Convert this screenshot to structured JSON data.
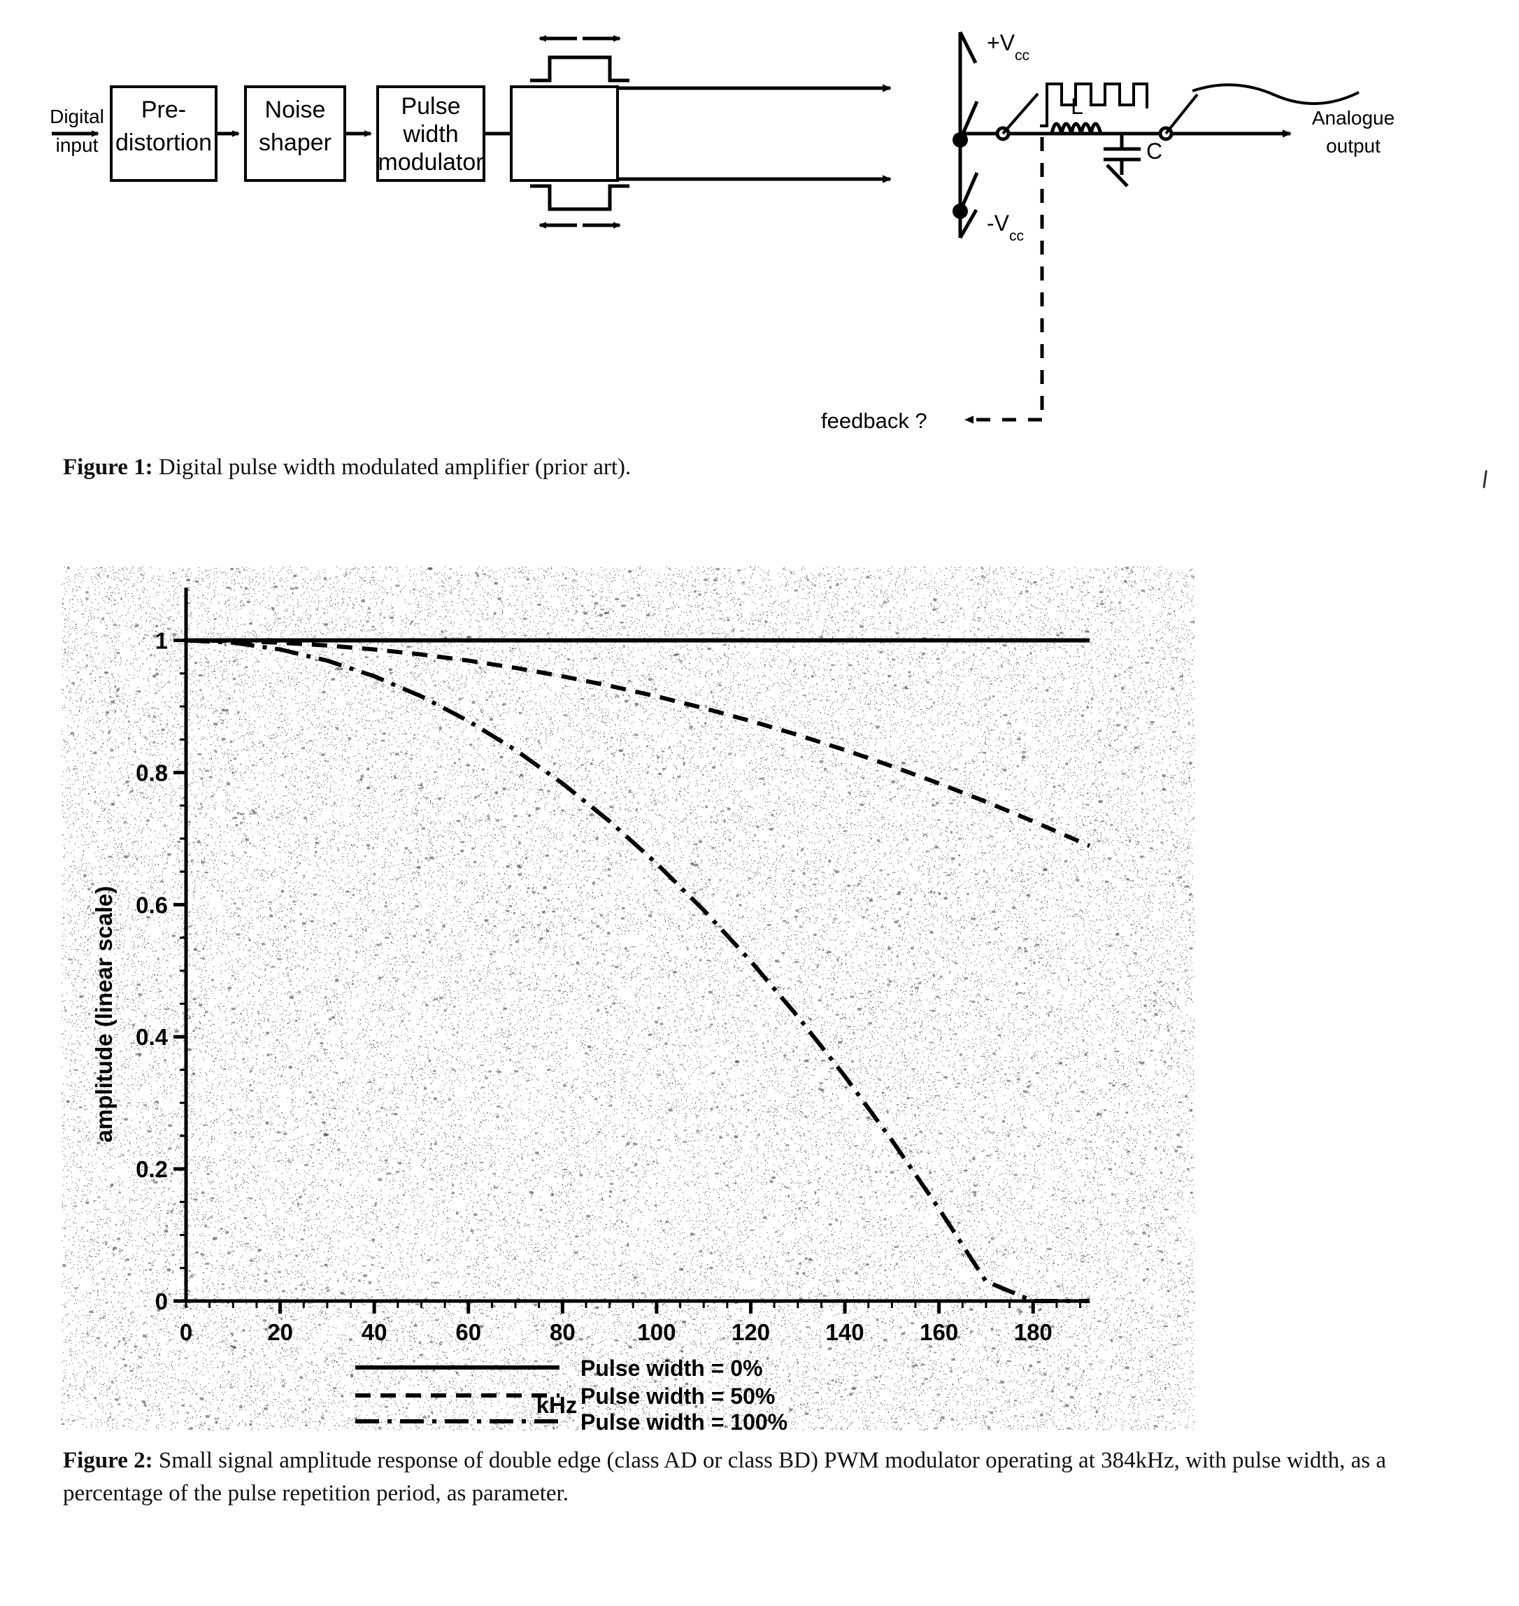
{
  "figure1": {
    "blocks": [
      {
        "id": "pre-distortion",
        "line1": "Pre-",
        "line2": "distortion"
      },
      {
        "id": "noise-shaper",
        "line1": "Noise",
        "line2": "shaper"
      },
      {
        "id": "pwm",
        "line1": "Pulse",
        "line2": "width",
        "line3": "modulator"
      },
      {
        "id": "output-stage",
        "line1": "",
        "line2": ""
      }
    ],
    "input_label_line1": "Digital",
    "input_label_line2": "input",
    "output_label_line1": "Analogue",
    "output_label_line2": "output",
    "supply_positive": "+V",
    "supply_positive_sub": "cc",
    "supply_negative": "-V",
    "supply_negative_sub": "cc",
    "inductor_label": "L",
    "capacitor_label": "C",
    "feedback_label": "feedback ?"
  },
  "caption1": {
    "prefix": "Figure 1:",
    "text": " Digital pulse width modulated amplifier (prior art)."
  },
  "caption2": {
    "prefix": "Figure 2:",
    "text": " Small signal amplitude response of double edge (class AD or class BD) PWM modulator operating at 384kHz, with pulse width, as a percentage of the pulse repetition period, as parameter."
  },
  "chart_data": {
    "type": "line",
    "title": "",
    "xlabel": "kHz",
    "ylabel": "amplitude (linear scale)",
    "xlim": [
      0,
      192
    ],
    "ylim": [
      0,
      1.08
    ],
    "xticks": [
      0,
      20,
      40,
      60,
      80,
      100,
      120,
      140,
      160,
      180
    ],
    "xtick_labels": [
      "0",
      "20",
      "40",
      "60",
      "80",
      "100",
      "120",
      "140",
      "160",
      "180"
    ],
    "yticks": [
      0,
      0.2,
      0.4,
      0.6,
      0.8,
      1
    ],
    "ytick_labels": [
      "0",
      "0.2",
      "0.4",
      "0.6",
      "0.8",
      "1"
    ],
    "minor_xtick_step": 5,
    "minor_ytick_step": 0.05,
    "grid": false,
    "legend_position": "bottom",
    "x": [
      0,
      10,
      20,
      30,
      40,
      50,
      60,
      70,
      80,
      90,
      100,
      110,
      120,
      130,
      140,
      150,
      160,
      170,
      180,
      192
    ],
    "series": [
      {
        "name": "Pulse width = 0%",
        "style": "solid",
        "values": [
          1,
          1,
          1,
          1,
          1,
          1,
          1,
          1,
          1,
          1,
          1,
          1,
          1,
          1,
          1,
          1,
          1,
          1,
          1,
          1
        ]
      },
      {
        "name": "Pulse width = 50%",
        "style": "dashed",
        "values": [
          1,
          0.9991,
          0.9966,
          0.9923,
          0.9863,
          0.9787,
          0.9694,
          0.9584,
          0.9457,
          0.9313,
          0.9153,
          0.8975,
          0.878,
          0.8569,
          0.8341,
          0.8096,
          0.7835,
          0.7557,
          0.7262,
          0.6889
        ]
      },
      {
        "name": "Pulse width = 100%",
        "style": "dashdot",
        "values": [
          1,
          0.9966,
          0.9863,
          0.9694,
          0.9457,
          0.9153,
          0.878,
          0.8341,
          0.7835,
          0.7262,
          0.6623,
          0.5917,
          0.5145,
          0.4306,
          0.3402,
          0.2432,
          0.1397,
          0.0297,
          0.0,
          0.0
        ]
      }
    ]
  }
}
